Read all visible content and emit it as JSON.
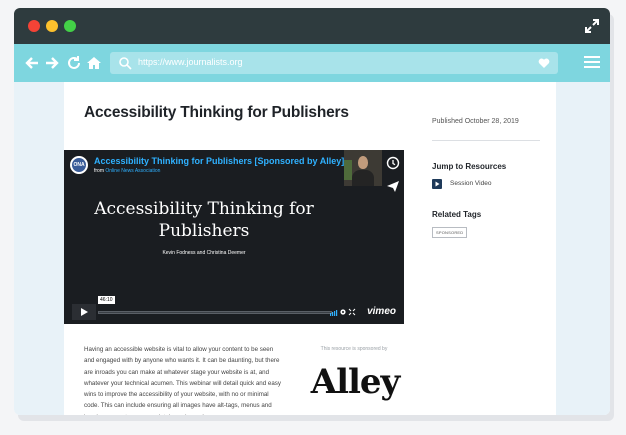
{
  "browser": {
    "url": "https://www.journalists.org"
  },
  "article": {
    "title": "Accessibility Thinking for Publishers",
    "body": "Having an accessible website is vital to allow your content to be seen and engaged with by anyone who wants it. It can be daunting, but there are inroads you can make at whatever stage your website is at, and whatever your technical acumen. This webinar will detail quick and easy wins to improve the accessibility of your website, with no or minimal code. This can include ensuring all images have alt-tags, menus and headers are set up appropriately, and more!"
  },
  "video": {
    "logo_text": "ONA",
    "header_title": "Accessibility Thinking for Publishers [Sponsored by Alley]",
    "from_label": "from",
    "from_source": "Online News Association",
    "main_title": "Accessibility Thinking for Publishers",
    "authors": "Kevin Fodness and Christina Deemer",
    "timestamp": "46:10",
    "brand": "vimeo"
  },
  "sponsor": {
    "caption": "This resource is sponsored by",
    "name": "Alley"
  },
  "sidebar": {
    "published": "Published October 28, 2019",
    "jump_heading": "Jump to Resources",
    "resources": [
      {
        "label": "Session Video",
        "icon": "video-play-icon"
      }
    ],
    "tags_heading": "Related Tags",
    "tags": [
      "SPONSORED"
    ]
  },
  "colors": {
    "titlebar": "#2e3b3e",
    "navbar": "#7ed6df",
    "accent_blue": "#2fb1ff"
  }
}
